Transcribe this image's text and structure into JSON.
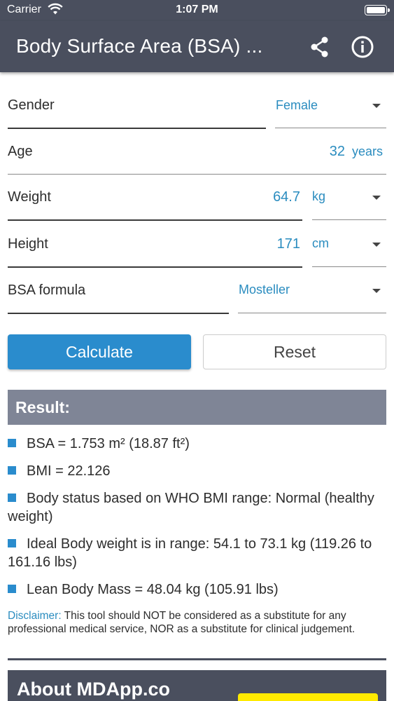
{
  "status_bar": {
    "carrier": "Carrier",
    "time": "1:07 PM"
  },
  "app_bar": {
    "title": "Body Surface Area (BSA) ...",
    "icons": [
      "share-icon",
      "info-icon"
    ]
  },
  "form": {
    "gender": {
      "label": "Gender",
      "value": "Female"
    },
    "age": {
      "label": "Age",
      "value": "32",
      "unit": "years"
    },
    "weight": {
      "label": "Weight",
      "value": "64.7",
      "unit": "kg"
    },
    "height": {
      "label": "Height",
      "value": "171",
      "unit": "cm"
    },
    "formula": {
      "label": "BSA formula",
      "value": "Mosteller"
    }
  },
  "buttons": {
    "calculate": "Calculate",
    "reset": "Reset"
  },
  "result": {
    "title": "Result:",
    "items": [
      "BSA = 1.753 m² (18.87 ft²)",
      "BMI = 22.126",
      "Body status based on WHO BMI range: Normal (healthy weight)",
      "Ideal Body weight is in range: 54.1 to 73.1 kg (119.26 to 161.16 lbs)",
      "Lean Body Mass = 48.04 kg (105.91 lbs)"
    ]
  },
  "disclaimer": {
    "label": "Disclaimer:",
    "text": " This tool should NOT be considered as a substitute for any professional medical service, NOR as a substitute for clinical judgement."
  },
  "about": {
    "title": "About MDApp.co"
  },
  "colors": {
    "header": "#4a4f5e",
    "accent": "#2a8ccd",
    "value_text": "#2a8cbf",
    "result_header": "#7f8596",
    "badge": "#ffea00"
  }
}
